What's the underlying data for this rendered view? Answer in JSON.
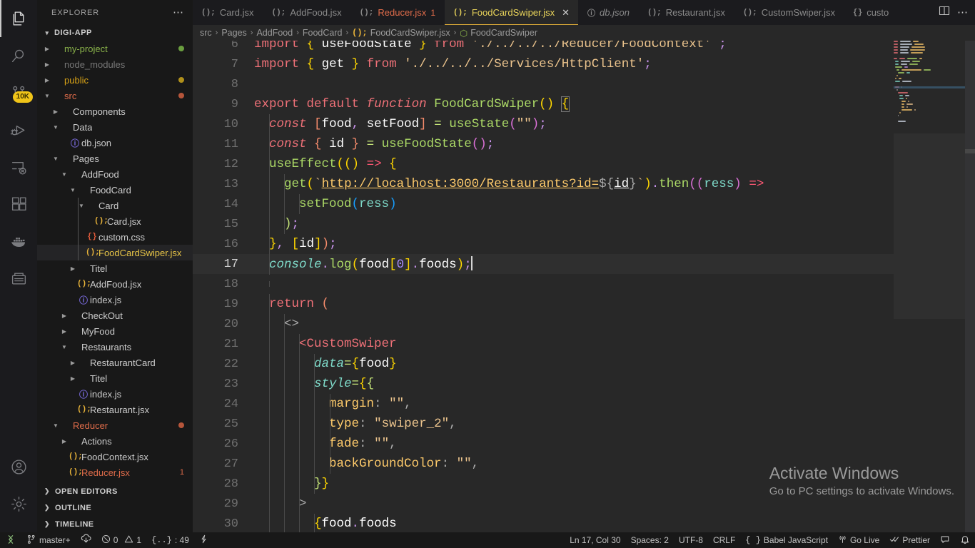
{
  "activitybar": {
    "items": [
      {
        "name": "explorer",
        "icon": "files-icon",
        "active": true,
        "badge": null
      },
      {
        "name": "search",
        "icon": "search-icon",
        "active": false,
        "badge": null
      },
      {
        "name": "source-control",
        "icon": "source-control-icon",
        "active": false,
        "badge": "10K"
      },
      {
        "name": "run-and-debug",
        "icon": "debug-icon",
        "active": false,
        "badge": null
      },
      {
        "name": "remote-explorer",
        "icon": "remote-explorer-icon",
        "active": false,
        "badge": null
      },
      {
        "name": "extensions",
        "icon": "extensions-icon",
        "active": false,
        "badge": null
      },
      {
        "name": "docker",
        "icon": "docker-icon",
        "active": false,
        "badge": null
      },
      {
        "name": "database",
        "icon": "database-icon",
        "active": false,
        "badge": null
      }
    ],
    "bottom": [
      {
        "name": "accounts",
        "icon": "account-icon"
      },
      {
        "name": "manage",
        "icon": "gear-icon"
      }
    ]
  },
  "sidebar": {
    "title": "EXPLORER",
    "more_label": "⋯",
    "root": {
      "label": "DIGI-APP",
      "expanded": true
    },
    "tree": [
      {
        "label": "my-project",
        "indent": 1,
        "type": "folder",
        "expanded": false,
        "color": "#8ab34a",
        "dot": "#6a9e3f"
      },
      {
        "label": "node_modules",
        "indent": 1,
        "type": "folder",
        "expanded": false,
        "color": "#777777",
        "dot": null
      },
      {
        "label": "public",
        "indent": 1,
        "type": "folder",
        "expanded": false,
        "color": "#d9a316",
        "dot": "#b0901b"
      },
      {
        "label": "src",
        "indent": 1,
        "type": "folder",
        "expanded": true,
        "color": "#e06c4a",
        "dot": "#b5553a"
      },
      {
        "label": "Components",
        "indent": 2,
        "type": "folder",
        "expanded": false,
        "color": "#cccccc",
        "dot": null
      },
      {
        "label": "Data",
        "indent": 2,
        "type": "folder",
        "expanded": true,
        "color": "#cccccc",
        "dot": null
      },
      {
        "label": "db.json",
        "indent": 3,
        "type": "json",
        "icon": "json-file-icon",
        "color": "#cccccc",
        "dot": null
      },
      {
        "label": "Pages",
        "indent": 2,
        "type": "folder",
        "expanded": true,
        "color": "#cccccc",
        "dot": null
      },
      {
        "label": "AddFood",
        "indent": 3,
        "type": "folder",
        "expanded": true,
        "color": "#cccccc",
        "dot": null
      },
      {
        "label": "FoodCard",
        "indent": 4,
        "type": "folder",
        "expanded": true,
        "color": "#cccccc",
        "dot": null
      },
      {
        "label": "Card",
        "indent": 5,
        "type": "folder",
        "expanded": true,
        "color": "#cccccc",
        "dot": null
      },
      {
        "label": "Card.jsx",
        "indent": 6,
        "type": "jsx",
        "icon": "jsx-file-icon",
        "color": "#cccccc",
        "dot": null
      },
      {
        "label": "custom.css",
        "indent": 5,
        "type": "css",
        "icon": "css-file-icon",
        "color": "#cccccc",
        "dot": null
      },
      {
        "label": "FoodCardSwiper.jsx",
        "indent": 5,
        "type": "jsx",
        "icon": "jsx-file-icon",
        "color": "#e8c547",
        "dot": null,
        "selected": true
      },
      {
        "label": "Titel",
        "indent": 4,
        "type": "folder",
        "expanded": false,
        "color": "#cccccc",
        "dot": null
      },
      {
        "label": "AddFood.jsx",
        "indent": 4,
        "type": "jsx",
        "icon": "jsx-file-icon",
        "color": "#cccccc",
        "dot": null
      },
      {
        "label": "index.js",
        "indent": 4,
        "type": "js",
        "icon": "js-file-icon",
        "color": "#cccccc",
        "dot": null
      },
      {
        "label": "CheckOut",
        "indent": 3,
        "type": "folder",
        "expanded": false,
        "color": "#cccccc",
        "dot": null
      },
      {
        "label": "MyFood",
        "indent": 3,
        "type": "folder",
        "expanded": false,
        "color": "#cccccc",
        "dot": null
      },
      {
        "label": "Restaurants",
        "indent": 3,
        "type": "folder",
        "expanded": true,
        "color": "#cccccc",
        "dot": null
      },
      {
        "label": "RestaurantCard",
        "indent": 4,
        "type": "folder",
        "expanded": false,
        "color": "#cccccc",
        "dot": null
      },
      {
        "label": "Titel",
        "indent": 4,
        "type": "folder",
        "expanded": false,
        "color": "#cccccc",
        "dot": null
      },
      {
        "label": "index.js",
        "indent": 4,
        "type": "js",
        "icon": "js-file-icon",
        "color": "#cccccc",
        "dot": null
      },
      {
        "label": "Restaurant.jsx",
        "indent": 4,
        "type": "jsx",
        "icon": "jsx-file-icon",
        "color": "#cccccc",
        "dot": null
      },
      {
        "label": "Reducer",
        "indent": 2,
        "type": "folder",
        "expanded": true,
        "color": "#e06c4a",
        "dot": "#b5553a"
      },
      {
        "label": "Actions",
        "indent": 3,
        "type": "folder",
        "expanded": false,
        "color": "#cccccc",
        "dot": null
      },
      {
        "label": "FoodContext.jsx",
        "indent": 3,
        "type": "jsx",
        "icon": "jsx-file-icon",
        "color": "#cccccc",
        "dot": null
      },
      {
        "label": "Reducer.jsx",
        "indent": 3,
        "type": "jsx",
        "icon": "jsx-file-icon",
        "color": "#e06c4a",
        "dot": null,
        "num": "1"
      }
    ],
    "collapsed_sections": [
      "OPEN EDITORS",
      "OUTLINE",
      "TIMELINE"
    ]
  },
  "tabs": [
    {
      "label": "Card.jsx",
      "icon": "jsx-file-icon",
      "active": false,
      "dirty": false,
      "italic": false,
      "badge": null
    },
    {
      "label": "AddFood.jsx",
      "icon": "jsx-file-icon",
      "active": false,
      "dirty": false,
      "italic": false,
      "badge": null
    },
    {
      "label": "Reducer.jsx",
      "icon": "jsx-file-icon",
      "active": false,
      "dirty": false,
      "italic": false,
      "badge": "1",
      "color": "#e06c4a"
    },
    {
      "label": "FoodCardSwiper.jsx",
      "icon": "jsx-file-icon",
      "active": true,
      "dirty": false,
      "italic": false,
      "badge": null,
      "close": "✕"
    },
    {
      "label": "db.json",
      "icon": "json-file-icon",
      "active": false,
      "dirty": false,
      "italic": true,
      "badge": null
    },
    {
      "label": "Restaurant.jsx",
      "icon": "jsx-file-icon",
      "active": false,
      "dirty": false,
      "italic": false,
      "badge": null
    },
    {
      "label": "CustomSwiper.jsx",
      "icon": "jsx-file-icon",
      "active": false,
      "dirty": false,
      "italic": false,
      "badge": null
    },
    {
      "label": "custo",
      "icon": "css-file-icon",
      "active": false,
      "dirty": false,
      "italic": false,
      "badge": null
    }
  ],
  "tabs_actions": {
    "split": "split-editor-icon",
    "more": "⋯"
  },
  "breadcrumb": [
    {
      "label": "src",
      "icon": null
    },
    {
      "label": "Pages",
      "icon": null
    },
    {
      "label": "AddFood",
      "icon": null
    },
    {
      "label": "FoodCard",
      "icon": null
    },
    {
      "label": "FoodCardSwiper.jsx",
      "icon": "jsx-file-icon"
    },
    {
      "label": "FoodCardSwiper",
      "icon": "symbol-class-icon"
    }
  ],
  "code": {
    "first_line": 6,
    "current_line": 17,
    "lines": [
      {
        "n": 6,
        "text": "import { useFoodState } from './../../../Reducer/FoodContext' ;"
      },
      {
        "n": 7,
        "text": "import { get } from './../../../Services/HttpClient';"
      },
      {
        "n": 8,
        "text": ""
      },
      {
        "n": 9,
        "text": "export default function FoodCardSwiper() {"
      },
      {
        "n": 10,
        "text": "  const [food, setFood] = useState(\"\");"
      },
      {
        "n": 11,
        "text": "  const { id } = useFoodState();"
      },
      {
        "n": 12,
        "text": "  useEffect(() => {"
      },
      {
        "n": 13,
        "text": "    get(`http://localhost:3000/Restaurants?id=${id}`).then((ress) =>"
      },
      {
        "n": 14,
        "text": "      setFood(ress)"
      },
      {
        "n": 15,
        "text": "    );"
      },
      {
        "n": 16,
        "text": "  }, [id]);"
      },
      {
        "n": 17,
        "text": "  console.log(food[0].foods);"
      },
      {
        "n": 18,
        "text": ""
      },
      {
        "n": 19,
        "text": "  return ("
      },
      {
        "n": 20,
        "text": "    <>"
      },
      {
        "n": 21,
        "text": "      <CustomSwiper"
      },
      {
        "n": 22,
        "text": "        data={food}"
      },
      {
        "n": 23,
        "text": "        style={{"
      },
      {
        "n": 24,
        "text": "          margin: \"\","
      },
      {
        "n": 25,
        "text": "          type: \"swiper_2\","
      },
      {
        "n": 26,
        "text": "          fade: \"\","
      },
      {
        "n": 27,
        "text": "          backGroundColor: \"\","
      },
      {
        "n": 28,
        "text": "        }}"
      },
      {
        "n": 29,
        "text": "      >"
      },
      {
        "n": 30,
        "text": "        {food.foods"
      }
    ]
  },
  "watermark": {
    "title": "Activate Windows",
    "subtitle": "Go to PC settings to activate Windows."
  },
  "statusbar": {
    "left": [
      {
        "name": "remote-indicator",
        "icon": "remote-icon",
        "label": ""
      },
      {
        "name": "branch",
        "icon": "git-branch-icon",
        "label": "master+"
      },
      {
        "name": "sync",
        "icon": "sync-icon",
        "label": ""
      },
      {
        "name": "problems",
        "icon": "error-warning-icon",
        "label": "0  1",
        "errors": "0",
        "warnings": "1"
      },
      {
        "name": "indent-stats",
        "icon": "braces-icon",
        "label": ": 49"
      },
      {
        "name": "flash",
        "icon": "flash-icon",
        "label": ""
      }
    ],
    "right": [
      {
        "name": "cursor-position",
        "label": "Ln 17, Col 30"
      },
      {
        "name": "indentation",
        "label": "Spaces: 2"
      },
      {
        "name": "encoding",
        "label": "UTF-8"
      },
      {
        "name": "eol",
        "label": "CRLF"
      },
      {
        "name": "language-mode",
        "label": "Babel JavaScript",
        "icon": "braces-icon"
      },
      {
        "name": "go-live",
        "label": "Go Live",
        "icon": "broadcast-icon"
      },
      {
        "name": "prettier",
        "label": "Prettier",
        "icon": "checkmarks-icon"
      },
      {
        "name": "feedback",
        "label": "",
        "icon": "feedback-icon"
      },
      {
        "name": "notifications",
        "label": "",
        "icon": "bell-icon"
      }
    ]
  },
  "colors": {
    "accent": "#e8b339",
    "editor_bg": "#282828",
    "sidebar_bg": "#181818",
    "activitybar_bg": "#1b1b1e",
    "statusbar_bg": "#181818",
    "selected_row": "#242426"
  }
}
